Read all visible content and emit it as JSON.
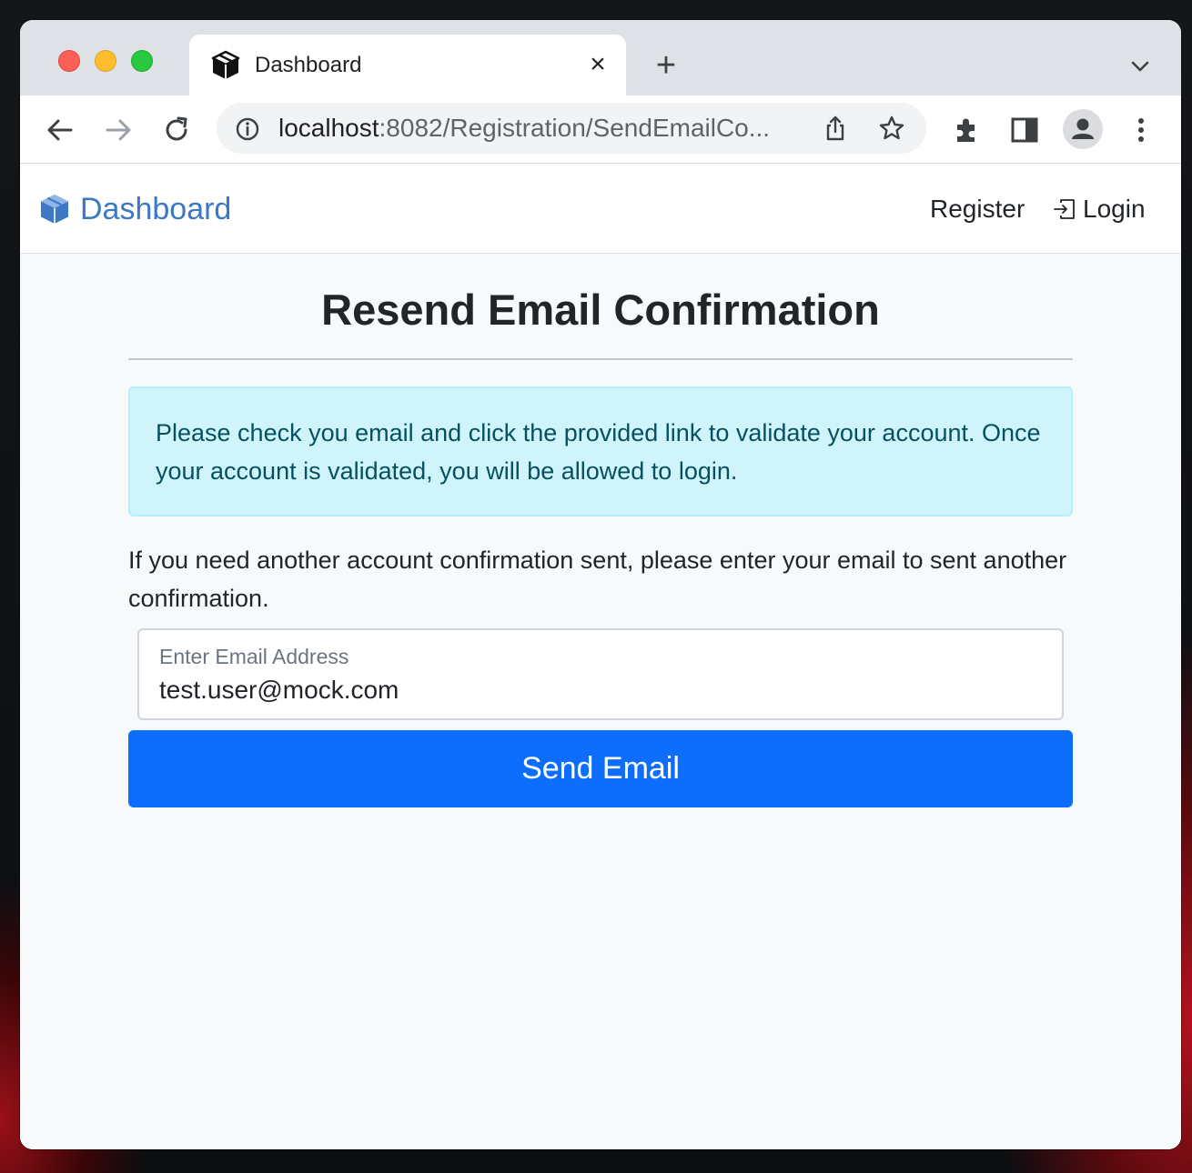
{
  "browser": {
    "tab_title": "Dashboard",
    "tab_close": "×",
    "new_tab": "+",
    "url_host": "localhost",
    "url_path": ":8082/Registration/SendEmailCo..."
  },
  "icons": {
    "tab_favicon": "box-icon",
    "back": "arrow-left-icon",
    "forward": "arrow-right-icon",
    "reload": "reload-icon",
    "site_info": "info-icon",
    "share": "share-icon",
    "bookmark": "star-icon",
    "extensions": "puzzle-icon",
    "side_panel": "side-panel-icon",
    "profile": "person-icon",
    "menu": "kebab-menu-icon",
    "tab_search": "chevron-down-icon",
    "brand": "box-icon",
    "login": "box-arrow-in-right-icon"
  },
  "navbar": {
    "brand": "Dashboard",
    "register": "Register",
    "login": "Login"
  },
  "main": {
    "heading": "Resend Email Confirmation",
    "alert": "Please check you email and click the provided link to validate your account. Once your account is validated, you will be allowed to login.",
    "help_text": "If you need another account confirmation sent, please enter your email to sent another confirmation.",
    "email_label": "Enter Email Address",
    "email_value": "test.user@mock.com",
    "send_button": "Send Email"
  },
  "colors": {
    "brand": "#3c78c4",
    "primary_button": "#0d6efd",
    "alert_bg": "#cff4fc",
    "alert_text": "#055160"
  }
}
